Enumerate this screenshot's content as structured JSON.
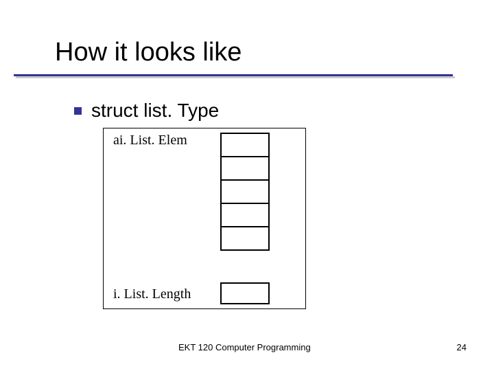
{
  "title": "How it looks like",
  "bullet": {
    "text": "struct list. Type"
  },
  "diagram": {
    "label_elem": "ai. List. Elem",
    "label_length": "i. List. Length",
    "array_cells": 5
  },
  "footer": {
    "course": "EKT 120 Computer Programming",
    "slide_number": "24"
  }
}
